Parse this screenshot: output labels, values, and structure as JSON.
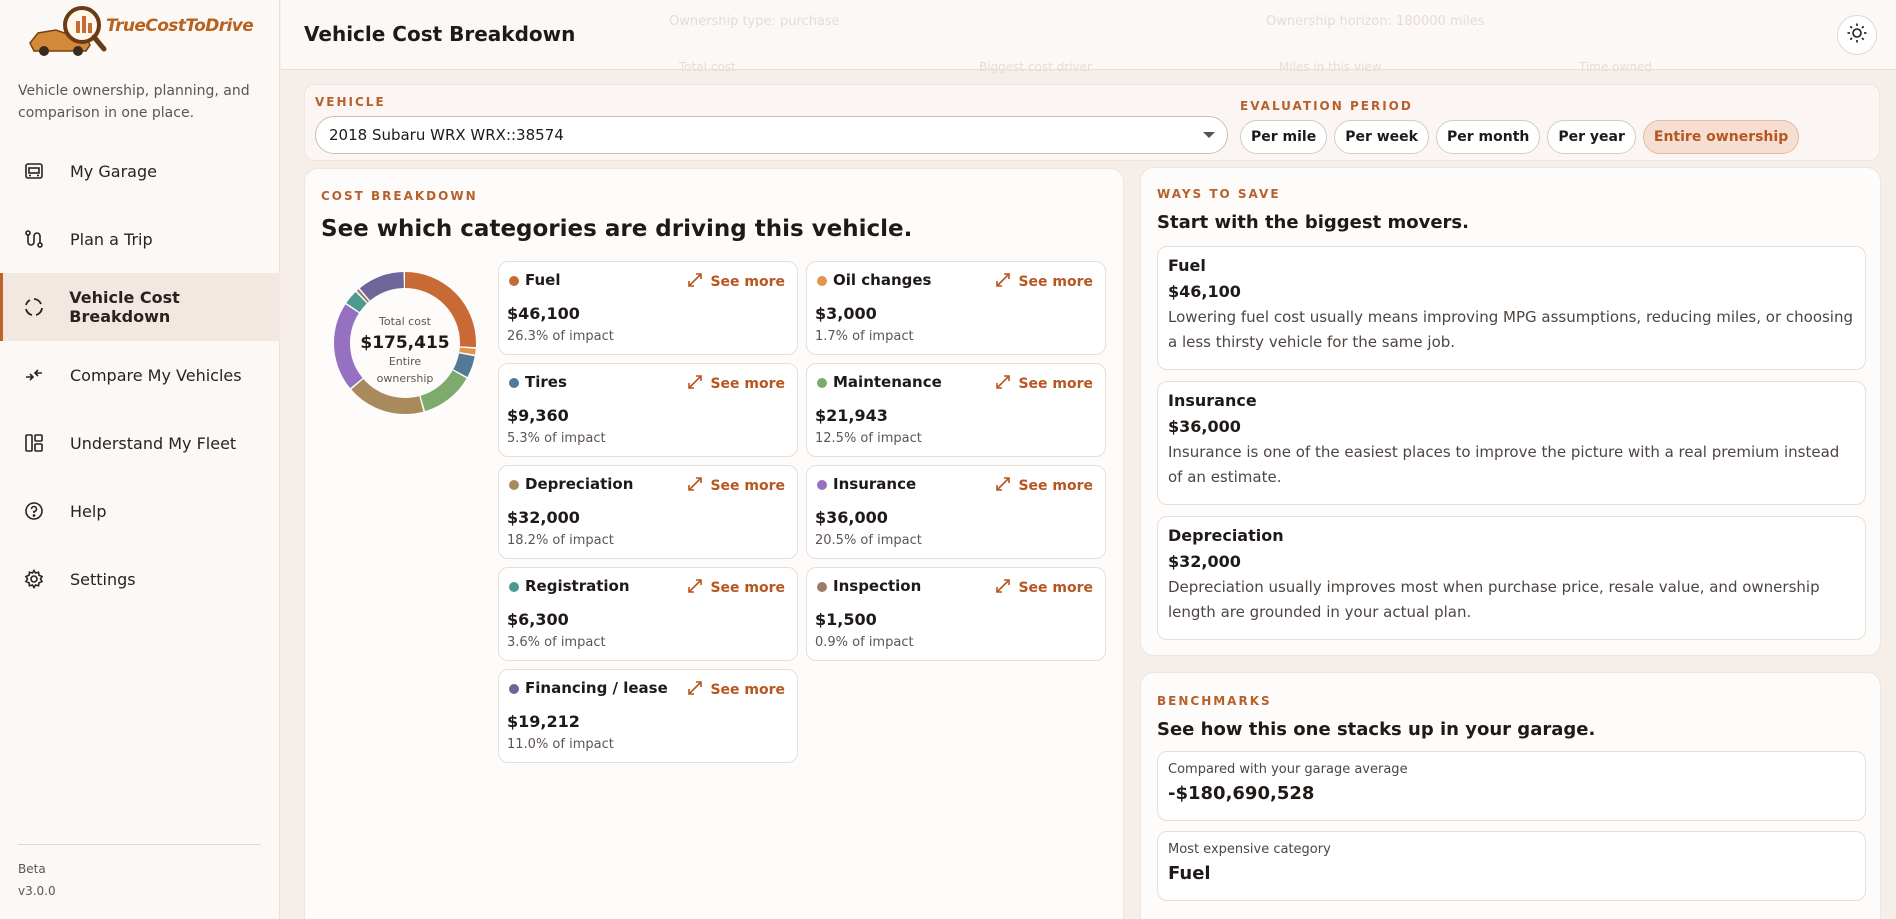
{
  "app": {
    "brand": "TrueCostToDrive",
    "tagline": "Vehicle ownership, planning, and comparison in one place.",
    "beta": "Beta",
    "version": "v3.0.0"
  },
  "nav": {
    "items": [
      {
        "label": "My Garage",
        "icon": "garage-icon"
      },
      {
        "label": "Plan a Trip",
        "icon": "route-icon"
      },
      {
        "label": "Vehicle Cost Breakdown",
        "icon": "loading-circle-icon",
        "active": true
      },
      {
        "label": "Compare My Vehicles",
        "icon": "compare-arrows-icon"
      },
      {
        "label": "Understand My Fleet",
        "icon": "dashboard-icon"
      },
      {
        "label": "Help",
        "icon": "help-circle-icon"
      },
      {
        "label": "Settings",
        "icon": "gear-icon"
      }
    ]
  },
  "header": {
    "title": "Vehicle Cost Breakdown",
    "ghost_left": "Ownership type: purchase",
    "ghost_right": "Ownership horizon: 180000 miles",
    "ghost_stats": [
      "Total cost",
      "Biggest cost driver",
      "Miles in this view",
      "Time owned"
    ]
  },
  "vehicle_panel": {
    "vehicle_label": "VEHICLE",
    "selected_vehicle": "2018 Subaru WRX WRX::38574",
    "period_label": "EVALUATION PERIOD",
    "periods": [
      "Per mile",
      "Per week",
      "Per month",
      "Per year",
      "Entire ownership"
    ],
    "active_period": "Entire ownership"
  },
  "breakdown": {
    "kicker": "COST BREAKDOWN",
    "title": "See which categories are driving this vehicle.",
    "see_more": "See more",
    "donut": {
      "label_top": "Total cost",
      "total": "$175,415",
      "label_bottom": "Entire ownership"
    },
    "categories": [
      {
        "name": "Fuel",
        "value": "$46,100",
        "impact": "26.3% of impact",
        "percent": 26.3,
        "color": "#c86a35"
      },
      {
        "name": "Oil changes",
        "value": "$3,000",
        "impact": "1.7% of impact",
        "percent": 1.7,
        "color": "#e0954a"
      },
      {
        "name": "Tires",
        "value": "$9,360",
        "impact": "5.3% of impact",
        "percent": 5.3,
        "color": "#527a96"
      },
      {
        "name": "Maintenance",
        "value": "$21,943",
        "impact": "12.5% of impact",
        "percent": 12.5,
        "color": "#7dab6e"
      },
      {
        "name": "Depreciation",
        "value": "$32,000",
        "impact": "18.2% of impact",
        "percent": 18.2,
        "color": "#a88a5c"
      },
      {
        "name": "Insurance",
        "value": "$36,000",
        "impact": "20.5% of impact",
        "percent": 20.5,
        "color": "#9670c1"
      },
      {
        "name": "Registration",
        "value": "$6,300",
        "impact": "3.6% of impact",
        "percent": 3.6,
        "color": "#4a9a8e"
      },
      {
        "name": "Inspection",
        "value": "$1,500",
        "impact": "0.9% of impact",
        "percent": 0.9,
        "color": "#9c7b6b"
      },
      {
        "name": "Financing / lease",
        "value": "$19,212",
        "impact": "11.0% of impact",
        "percent": 11.0,
        "color": "#6e6598"
      }
    ]
  },
  "ways_to_save": {
    "kicker": "WAYS TO SAVE",
    "title": "Start with the biggest movers.",
    "items": [
      {
        "name": "Fuel",
        "value": "$46,100",
        "desc": "Lowering fuel cost usually means improving MPG assumptions, reducing miles, or choosing a less thirsty vehicle for the same job."
      },
      {
        "name": "Insurance",
        "value": "$36,000",
        "desc": "Insurance is one of the easiest places to improve the picture with a real premium instead of an estimate."
      },
      {
        "name": "Depreciation",
        "value": "$32,000",
        "desc": "Depreciation usually improves most when purchase price, resale value, and ownership length are grounded in your actual plan."
      }
    ]
  },
  "benchmarks": {
    "kicker": "BENCHMARKS",
    "title": "See how this one stacks up in your garage.",
    "items": [
      {
        "label": "Compared with your garage average",
        "value": "-$180,690,528"
      },
      {
        "label": "Most expensive category",
        "value": "Fuel"
      }
    ]
  }
}
